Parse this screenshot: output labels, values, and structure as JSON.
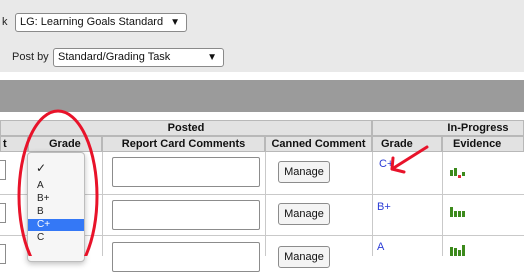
{
  "filters": {
    "task_label_fragment": "k",
    "task_value": "LG: Learning Goals Standard",
    "postby_label": "Post by",
    "postby_value": "Standard/Grading Task"
  },
  "table": {
    "posted_header": "Posted",
    "inprogress_header": "In-Progress",
    "truncated_col": "t",
    "columns": {
      "grade": "Grade",
      "report_card_comments": "Report Card Comments",
      "canned_comment": "Canned Comment",
      "ip_grade": "Grade",
      "evidence": "Evidence"
    },
    "rows": [
      {
        "manage_label": "Manage",
        "inprogress_grade": "C+"
      },
      {
        "manage_label": "Manage",
        "inprogress_grade": "B+"
      },
      {
        "manage_label": "Manage",
        "inprogress_grade": "A"
      }
    ]
  },
  "grade_dropdown": {
    "options": [
      "A",
      "B+",
      "B",
      "C+",
      "C"
    ],
    "selected": "C+"
  },
  "annotation_colors": {
    "circle": "#e8132a",
    "arrow": "#e8132a"
  },
  "evidence_colors": {
    "green": "#3c8a1c",
    "red": "#e0263a"
  }
}
